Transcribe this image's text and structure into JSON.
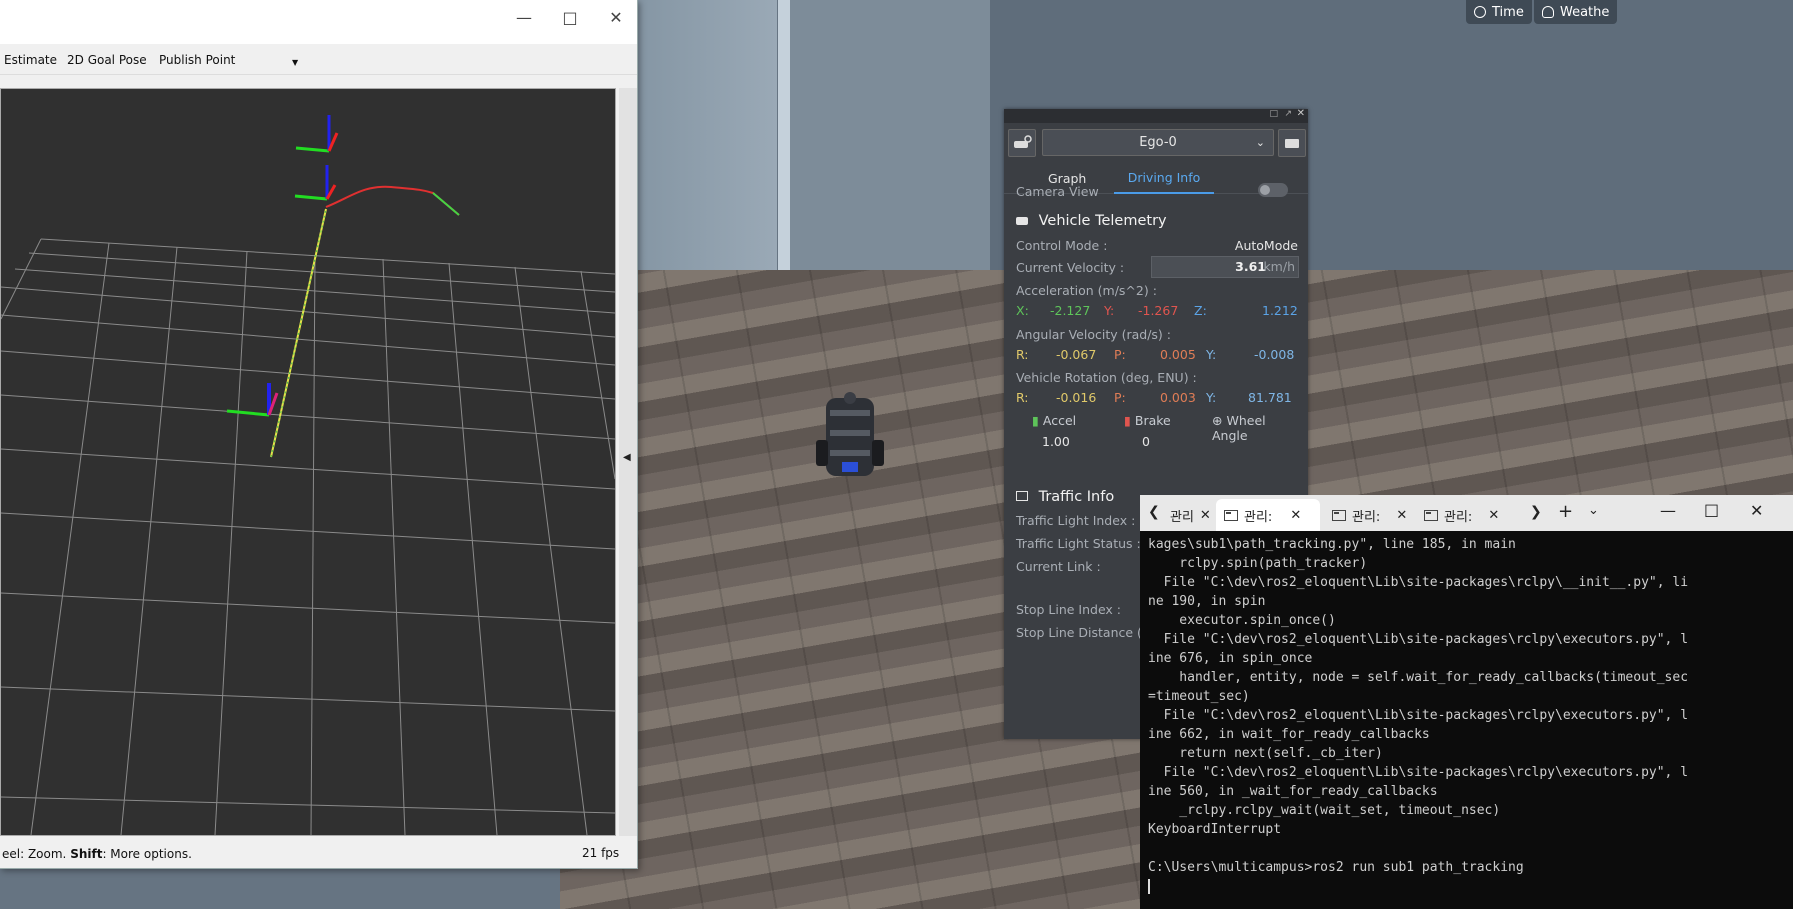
{
  "sim": {
    "time_label": "Time",
    "weather_label": "Weathe"
  },
  "rviz": {
    "toolbar": {
      "pose_estimate": "Estimate",
      "goal_pose": "2D Goal Pose",
      "publish_point": "Publish Point"
    },
    "status": {
      "hint_prefix": "eel: Zoom. ",
      "hint_key": "Shift",
      "hint_suffix": ": More options.",
      "fps": "21 fps"
    }
  },
  "panel": {
    "vehicle_select": "Ego-0",
    "tabs": [
      {
        "label": "Graph"
      },
      {
        "label": "Driving Info"
      }
    ],
    "active_tab": "Driving Info",
    "camera_view_label": "Camera View",
    "camera_view_on": false,
    "telemetry_title": "Vehicle Telemetry",
    "control_mode_label": "Control Mode :",
    "control_mode_value": "AutoMode",
    "velocity_label": "Current Velocity :",
    "velocity_value": "3.61",
    "velocity_unit": "km/h",
    "accel_label": "Acceleration (m/s^2) :",
    "accel": {
      "x_label": "X:",
      "x": "-2.127",
      "y_label": "Y:",
      "y": "-1.267",
      "z_label": "Z:",
      "z": "1.212"
    },
    "angvel_label": "Angular Velocity (rad/s) :",
    "angvel": {
      "r_label": "R:",
      "r": "-0.067",
      "p_label": "P:",
      "p": "0.005",
      "y_label": "Y:",
      "y": "-0.008"
    },
    "rotation_label": "Vehicle Rotation (deg, ENU) :",
    "rotation": {
      "r_label": "R:",
      "r": "-0.016",
      "p_label": "P:",
      "p": "0.003",
      "y_label": "Y:",
      "y": "81.781"
    },
    "accel_title": "Accel",
    "brake_title": "Brake",
    "wheel_title": "Wheel Angle",
    "accel_value": "1.00",
    "brake_value_partial": "0",
    "traffic_title": "Traffic Info",
    "traffic_light_index": "Traffic Light Index :",
    "traffic_light_status": "Traffic Light Status :",
    "current_link": "Current Link :",
    "stop_line_index": "Stop Line Index :",
    "stop_line_distance": "Stop Line Distance (m"
  },
  "terminal": {
    "tabs": [
      {
        "label": "관리"
      },
      {
        "label": "관리:"
      },
      {
        "label": "관리:"
      },
      {
        "label": "관리:"
      }
    ],
    "lines": [
      "kages\\sub1\\path_tracking.py\", line 185, in main",
      "    rclpy.spin(path_tracker)",
      "  File \"C:\\dev\\ros2_eloquent\\Lib\\site-packages\\rclpy\\__init__.py\", li",
      "ne 190, in spin",
      "    executor.spin_once()",
      "  File \"C:\\dev\\ros2_eloquent\\Lib\\site-packages\\rclpy\\executors.py\", l",
      "ine 676, in spin_once",
      "    handler, entity, node = self.wait_for_ready_callbacks(timeout_sec",
      "=timeout_sec)",
      "  File \"C:\\dev\\ros2_eloquent\\Lib\\site-packages\\rclpy\\executors.py\", l",
      "ine 662, in wait_for_ready_callbacks",
      "    return next(self._cb_iter)",
      "  File \"C:\\dev\\ros2_eloquent\\Lib\\site-packages\\rclpy\\executors.py\", l",
      "ine 560, in _wait_for_ready_callbacks",
      "    _rclpy.rclpy_wait(wait_set, timeout_nsec)",
      "KeyboardInterrupt",
      "",
      "C:\\Users\\multicampus>ros2 run sub1 path_tracking"
    ]
  }
}
